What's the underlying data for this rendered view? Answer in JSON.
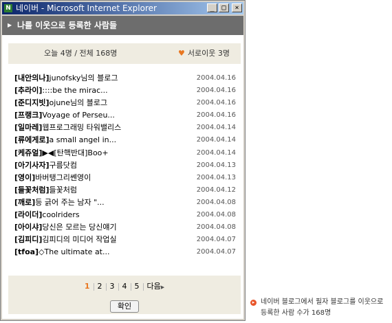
{
  "window": {
    "title": "네이버 - Microsoft Internet Explorer",
    "app_icon_letter": "N",
    "minimize": "_",
    "maximize": "□",
    "close": "×"
  },
  "header": {
    "title": "나를 이웃으로 등록한 사람들"
  },
  "summary": {
    "counts": "오늘 4명 / 전체 168명",
    "mutual": "서로이웃 3명"
  },
  "neighbors": [
    {
      "name": "[내안의나]",
      "desc": "junofsky님의 블로그",
      "date": "2004.04.16"
    },
    {
      "name": "[추라이]",
      "desc": "::::be the mirac...",
      "date": "2004.04.16"
    },
    {
      "name": "[준디지빗]",
      "desc": "ojune님의 블로그",
      "date": "2004.04.16"
    },
    {
      "name": "[프랭크]",
      "desc": "Voyage of Perseu...",
      "date": "2004.04.16"
    },
    {
      "name": "[일마레]",
      "desc": "웹프로그래밍 타워밸리스",
      "date": "2004.04.14"
    },
    {
      "name": "[류에게로]",
      "desc": "a small angel in...",
      "date": "2004.04.14"
    },
    {
      "name": "[케쥬얼]",
      "desc": "▶◀[탄핵반대]Boo+",
      "date": "2004.04.14"
    },
    {
      "name": "[아기사자]",
      "desc": "구름닷컴",
      "date": "2004.04.13"
    },
    {
      "name": "[영이]",
      "desc": "바버탱그리쎈영이",
      "date": "2004.04.13"
    },
    {
      "name": "[들꽃처럼]",
      "desc": "들꽃처럼",
      "date": "2004.04.12"
    },
    {
      "name": "[깨로]",
      "desc": "등 긁어 주는 남자 \"...",
      "date": "2004.04.08"
    },
    {
      "name": "[라이더]",
      "desc": "coolriders",
      "date": "2004.04.08"
    },
    {
      "name": "[아이샤]",
      "desc": "당신은 모르는 당신얘기",
      "date": "2004.04.08"
    },
    {
      "name": "[김피디]",
      "desc": "김피디의 미디어 작업실",
      "date": "2004.04.07"
    },
    {
      "name": "[tfoa]",
      "desc": "◇The ultimate at...",
      "date": "2004.04.07"
    }
  ],
  "pagination": {
    "pages": [
      "1",
      "2",
      "3",
      "4",
      "5"
    ],
    "current": "1",
    "next": "다음"
  },
  "ok_button": "확인",
  "caption": {
    "line1": "네이버 블로그에서 필자 블로그를 이웃으로",
    "line2": "등록한 사람 수가 168명"
  }
}
